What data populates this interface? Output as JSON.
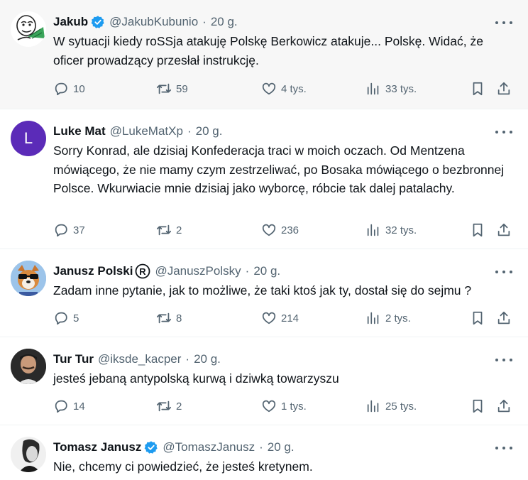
{
  "tweets": [
    {
      "name": "Jakub",
      "verified": true,
      "handle": "@JakubKubunio",
      "time": "20 g.",
      "text": "W sytuacji kiedy roSSja atakuję Polskę Berkowicz atakuje... Polskę. Widać, że oficer prowadzący przesłał instrukcję.",
      "replies": "10",
      "reposts": "59",
      "likes": "4 tys.",
      "views": "33 tys."
    },
    {
      "name": "Luke Mat",
      "verified": false,
      "handle": "@LukeMatXp",
      "time": "20 g.",
      "avatar_letter": "L",
      "avatar_color": "#5b2bb8",
      "text": "Sorry Konrad, ale dzisiaj Konfederacja traci w moich oczach. Od Mentzena mówiącego, że nie mamy czym zestrzeliwać, po Bosaka mówiącego o bezbronnej Polsce. Wkurwiacie mnie dzisiaj jako wyborcę, róbcie tak dalej patalachy.",
      "replies": "37",
      "reposts": "2",
      "likes": "236",
      "views": "32 tys."
    },
    {
      "name": "Janusz Polski",
      "verified": false,
      "handle": "@JanuszPolsky",
      "time": "20 g.",
      "text": "Zadam inne pytanie, jak to możliwe, że taki ktoś jak ty, dostał się do sejmu ?",
      "replies": "5",
      "reposts": "8",
      "likes": "214",
      "views": "2 tys."
    },
    {
      "name": "Tur Tur",
      "verified": false,
      "handle": "@iksde_kacper",
      "time": "20 g.",
      "text": "jesteś jebaną antypolską kurwą i dziwką towarzyszu",
      "replies": "14",
      "reposts": "2",
      "likes": "1 tys.",
      "views": "25 tys."
    },
    {
      "name": "Tomasz Janusz",
      "verified": true,
      "handle": "@TomaszJanusz",
      "time": "20 g.",
      "text": "Nie, chcemy ci powiedzieć, że jesteś kretynem."
    }
  ],
  "icons": {
    "reply": "reply-icon",
    "repost": "repost-icon",
    "like": "heart-icon",
    "views": "views-icon",
    "bookmark": "bookmark-icon",
    "share": "share-icon",
    "more": "more-icon"
  },
  "colors": {
    "verified": "#1d9bf0",
    "muted": "#536471",
    "highlight_bg": "#f7f7f7"
  }
}
